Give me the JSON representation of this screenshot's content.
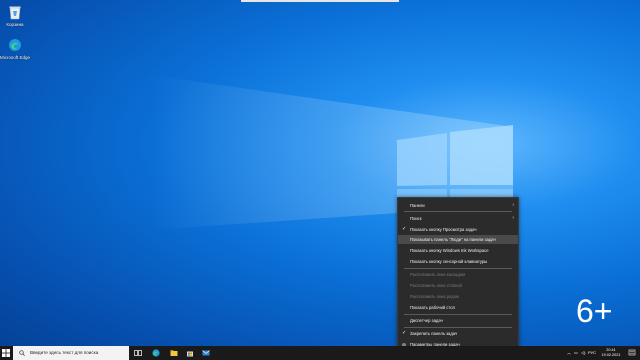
{
  "desktop": {
    "icons": [
      {
        "label": "Корзина",
        "icon": "recycle-bin-icon"
      },
      {
        "label": "Microsoft Edge",
        "icon": "edge-icon"
      }
    ],
    "age_badge": "6+"
  },
  "context_menu": {
    "items": [
      {
        "label": "Панели",
        "submenu": true
      },
      {
        "label": "Поиск",
        "submenu": true
      },
      {
        "label": "Показать кнопку Просмотра задач",
        "checked": true
      },
      {
        "label": "Показывать панель \"Люди\" на панели задач",
        "highlighted": true
      },
      {
        "label": "Показать кнопку Windows Ink Workspace"
      },
      {
        "label": "Показать кнопку сенсорной клавиатуры"
      },
      {
        "label": "Расположить окна каскадом",
        "disabled": true
      },
      {
        "label": "Расположить окна стопкой",
        "disabled": true
      },
      {
        "label": "Расположить окна рядом",
        "disabled": true
      },
      {
        "label": "Показать рабочий стол"
      },
      {
        "label": "Диспетчер задач"
      },
      {
        "label": "Закрепить панель задач",
        "checked": true
      },
      {
        "label": "Параметры панели задач",
        "icon": "gear-icon"
      }
    ]
  },
  "taskbar": {
    "search_placeholder": "Введите здесь текст для поиска",
    "pinned": [
      "task-view-icon",
      "edge-icon",
      "file-explorer-icon",
      "store-icon",
      "mail-icon"
    ],
    "tray": {
      "language": "РУС",
      "time": "20:41",
      "date": "19.02.2021"
    }
  },
  "colors": {
    "menu_bg": "#2b2b2b",
    "taskbar_bg": "#1a1a1a",
    "desktop_blue": "#0a6fd6"
  }
}
